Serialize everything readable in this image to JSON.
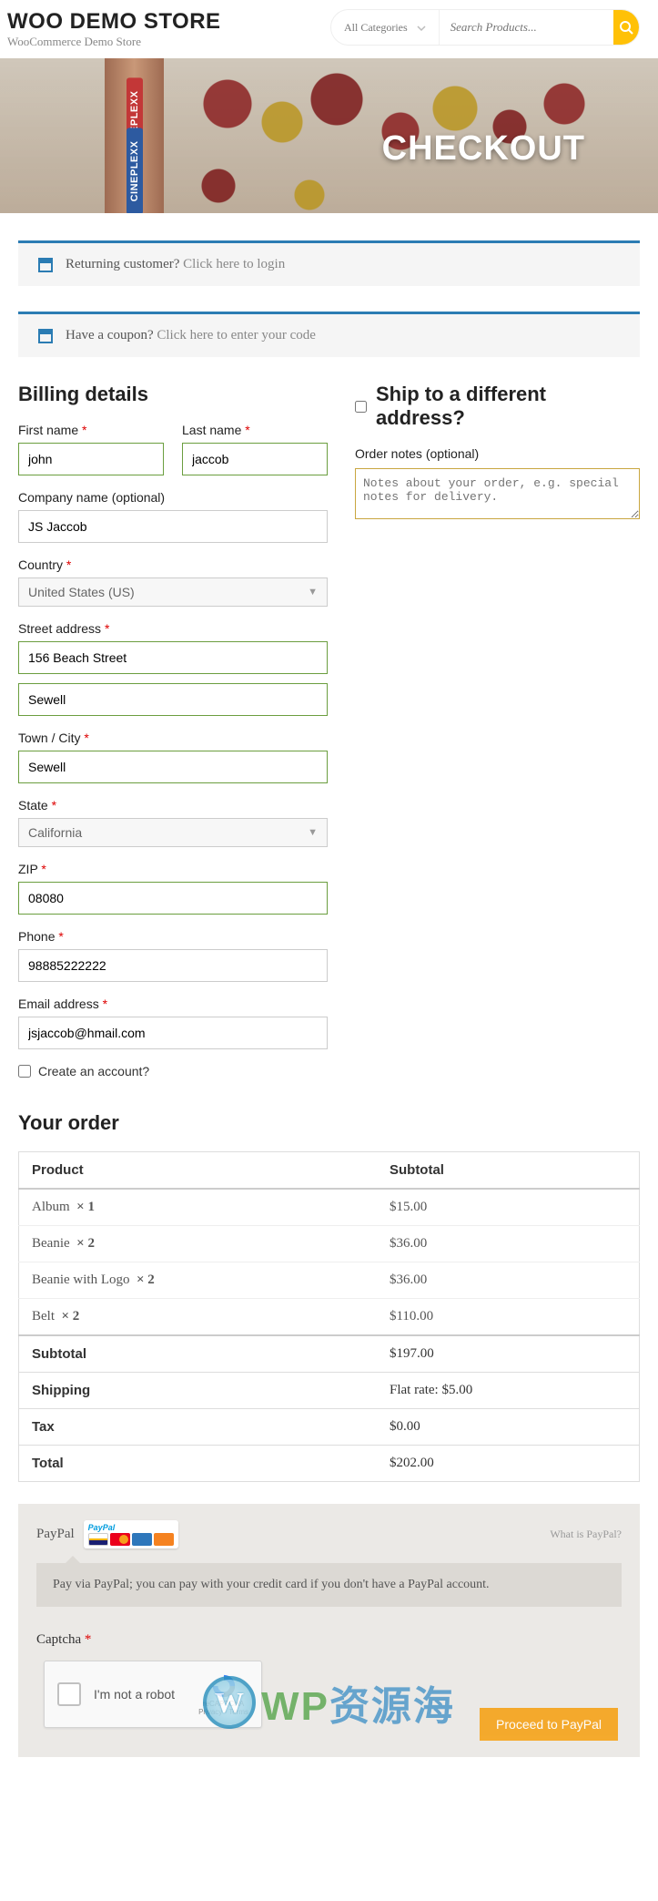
{
  "header": {
    "brand_title": "WOO DEMO STORE",
    "brand_sub": "WooCommerce Demo Store",
    "category_label": "All Categories",
    "search_placeholder": "Search Products..."
  },
  "hero": {
    "title": "CHECKOUT",
    "sign_red": "CINEPLEXX",
    "sign_blue": "CINEPLEXX"
  },
  "notices": {
    "returning_pre": "Returning customer? ",
    "returning_link": "Click here to login",
    "coupon_pre": "Have a coupon? ",
    "coupon_link": "Click here to enter your code"
  },
  "billing": {
    "section_title": "Billing details",
    "first_name_label": "First name",
    "first_name_value": "john",
    "last_name_label": "Last name",
    "last_name_value": "jaccob",
    "company_label": "Company name (optional)",
    "company_value": "JS Jaccob",
    "country_label": "Country",
    "country_value": "United States (US)",
    "street_label": "Street address",
    "street1_value": "156 Beach Street",
    "street2_value": "Sewell",
    "city_label": "Town / City",
    "city_value": "Sewell",
    "state_label": "State",
    "state_value": "California",
    "zip_label": "ZIP",
    "zip_value": "08080",
    "phone_label": "Phone",
    "phone_value": "98885222222",
    "email_label": "Email address",
    "email_value": "jsjaccob@hmail.com",
    "create_account_label": "Create an account?"
  },
  "shipping": {
    "ship_diff_label": "Ship to a different address?",
    "notes_label": "Order notes (optional)",
    "notes_placeholder": "Notes about your order, e.g. special notes for delivery."
  },
  "order": {
    "section_title": "Your order",
    "col_product": "Product",
    "col_subtotal": "Subtotal",
    "items": [
      {
        "name": "Album",
        "qty": "× 1",
        "subtotal": "$15.00"
      },
      {
        "name": "Beanie",
        "qty": "× 2",
        "subtotal": "$36.00"
      },
      {
        "name": "Beanie with Logo",
        "qty": "× 2",
        "subtotal": "$36.00"
      },
      {
        "name": "Belt",
        "qty": "× 2",
        "subtotal": "$110.00"
      }
    ],
    "subtotal_label": "Subtotal",
    "subtotal_value": "$197.00",
    "shipping_label": "Shipping",
    "shipping_value": "Flat rate: $5.00",
    "tax_label": "Tax",
    "tax_value": "$0.00",
    "total_label": "Total",
    "total_value": "$202.00"
  },
  "payment": {
    "paypal_label": "PayPal",
    "pp_brand_a": "Pay",
    "pp_brand_b": "Pal",
    "what_is": "What is PayPal?",
    "desc": "Pay via PayPal; you can pay with your credit card if you don't have a PayPal account.",
    "captcha_label": "Captcha",
    "recaptcha_text": "I'm not a robot",
    "recaptcha_badge": "reCAPTCHA",
    "recaptcha_terms": "Privacy - Terms",
    "proceed_btn": "Proceed to PayPal"
  },
  "watermark": {
    "w": "W",
    "text_a": "WP",
    "text_b": "资源海"
  }
}
